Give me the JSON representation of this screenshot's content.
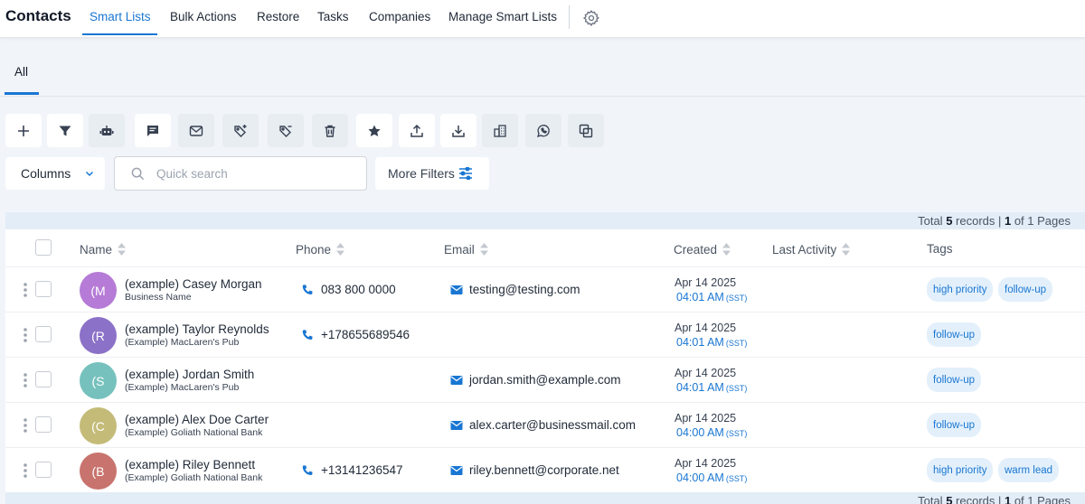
{
  "app": {
    "title": "Contacts"
  },
  "nav": {
    "tabs": [
      "Smart Lists",
      "Bulk Actions",
      "Restore",
      "Tasks",
      "Companies",
      "Manage Smart Lists"
    ],
    "active": "Smart Lists"
  },
  "subtabs": [
    "All"
  ],
  "toolbar": {
    "icons": [
      "plus-icon",
      "filter-icon",
      "robot-icon",
      "message-icon",
      "email-icon",
      "tag-add-icon",
      "tag-remove-icon",
      "trash-icon",
      "star-icon",
      "upload-icon",
      "download-icon",
      "building-icon",
      "whatsapp-icon",
      "copy-icon"
    ]
  },
  "filters": {
    "columns_label": "Columns",
    "search_placeholder": "Quick search",
    "more_filters_label": "More Filters"
  },
  "records": {
    "prefix": "Total ",
    "count": "5",
    "mid": " records | ",
    "page": "1",
    "suffix": " of 1 Pages"
  },
  "table": {
    "headers": {
      "name": "Name",
      "phone": "Phone",
      "email": "Email",
      "created": "Created",
      "last_activity": "Last Activity",
      "tags": "Tags"
    },
    "rows": [
      {
        "initials": "(M",
        "name": "(example) Casey Morgan",
        "sub": "Business Name",
        "phone": "083 800 0000",
        "email": "testing@testing.com",
        "date": "Apr 14 2025",
        "time": "04:01 AM",
        "tz": "(SST)",
        "tags": [
          "high priority",
          "follow-up"
        ],
        "color": "#b57bd6"
      },
      {
        "initials": "(R",
        "name": "(example) Taylor Reynolds",
        "sub": "(Example) MacLaren's Pub",
        "phone": "+178655689546",
        "email": "",
        "date": "Apr 14 2025",
        "time": "04:01 AM",
        "tz": "(SST)",
        "tags": [
          "follow-up"
        ],
        "color": "#8c71c8"
      },
      {
        "initials": "(S",
        "name": "(example) Jordan Smith",
        "sub": "(Example) MacLaren's Pub",
        "phone": "",
        "email": "jordan.smith@example.com",
        "date": "Apr 14 2025",
        "time": "04:01 AM",
        "tz": "(SST)",
        "tags": [
          "follow-up"
        ],
        "color": "#76c1bd"
      },
      {
        "initials": "(C",
        "name": "(example) Alex Doe Carter",
        "sub": "(Example) Goliath National Bank",
        "phone": "",
        "email": "alex.carter@businessmail.com",
        "date": "Apr 14 2025",
        "time": "04:00 AM",
        "tz": "(SST)",
        "tags": [
          "follow-up"
        ],
        "color": "#c4bb78"
      },
      {
        "initials": "(B",
        "name": "(example) Riley Bennett",
        "sub": "(Example) Goliath National Bank",
        "phone": "+13141236547",
        "email": "riley.bennett@corporate.net",
        "date": "Apr 14 2025",
        "time": "04:00 AM",
        "tz": "(SST)",
        "tags": [
          "high priority",
          "warm lead"
        ],
        "color": "#c8736d"
      }
    ]
  },
  "colors": {
    "accent": "#1976d2",
    "tag_bg": "#e3f0fb"
  }
}
